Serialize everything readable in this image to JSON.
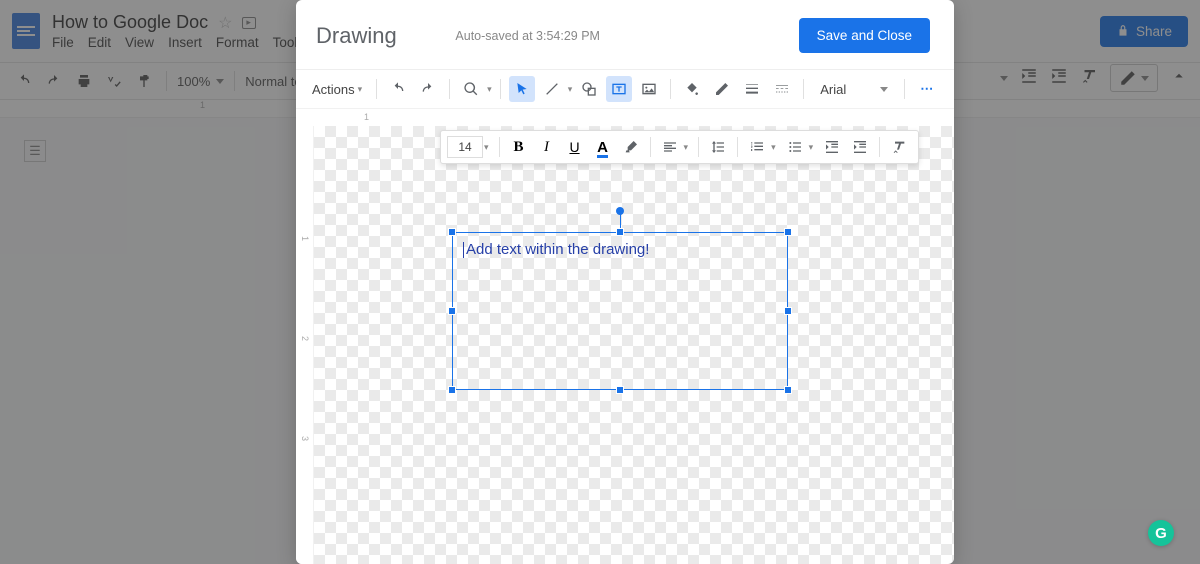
{
  "doc": {
    "title": "How to Google Doc",
    "menus": [
      "File",
      "Edit",
      "View",
      "Insert",
      "Format",
      "Tools"
    ],
    "zoom": "100%",
    "paragraph_style": "Normal text",
    "share_label": "Share",
    "ruler_label": "1"
  },
  "drawing": {
    "title": "Drawing",
    "autosave": "Auto-saved at 3:54:29 PM",
    "save_close": "Save and Close",
    "actions_label": "Actions",
    "font_family": "Arial",
    "ruler_label": "1",
    "vruler_labels": [
      "1",
      "2",
      "3"
    ]
  },
  "text_toolbar": {
    "font_size": "14"
  },
  "textbox": {
    "content": "Add text within the drawing!"
  }
}
